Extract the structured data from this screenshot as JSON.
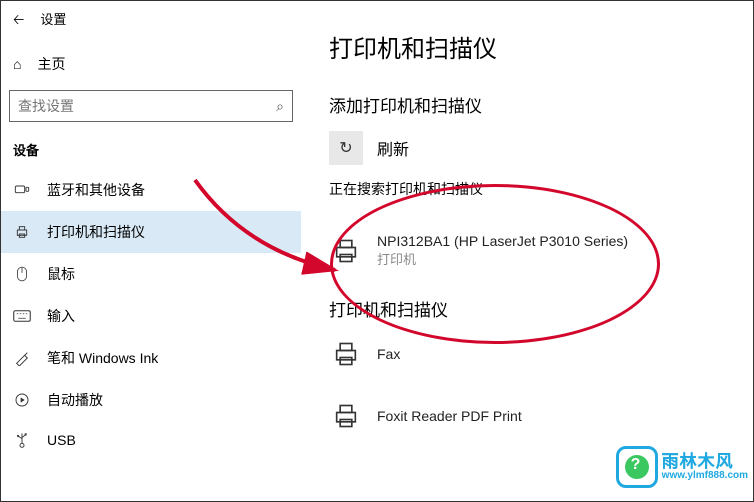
{
  "topbar": {
    "settings": "设置"
  },
  "home": {
    "label": "主页"
  },
  "search": {
    "placeholder": "查找设置"
  },
  "section": {
    "label": "设备"
  },
  "nav": {
    "items": [
      {
        "label": "蓝牙和其他设备"
      },
      {
        "label": "打印机和扫描仪"
      },
      {
        "label": "鼠标"
      },
      {
        "label": "输入"
      },
      {
        "label": "笔和 Windows Ink"
      },
      {
        "label": "自动播放"
      },
      {
        "label": "USB"
      }
    ]
  },
  "page": {
    "title": "打印机和扫描仪",
    "add_title": "添加打印机和扫描仪",
    "refresh_label": "刷新",
    "searching": "正在搜索打印机和扫描仪",
    "found": {
      "name": "NPI312BA1 (HP LaserJet P3010 Series)",
      "sub": "打印机"
    },
    "list_title": "打印机和扫描仪",
    "printers": [
      {
        "name": "Fax"
      },
      {
        "name": "Foxit Reader PDF Print"
      }
    ]
  },
  "watermark": {
    "cn": "雨林木风",
    "url": "www.ylmf888.com"
  }
}
